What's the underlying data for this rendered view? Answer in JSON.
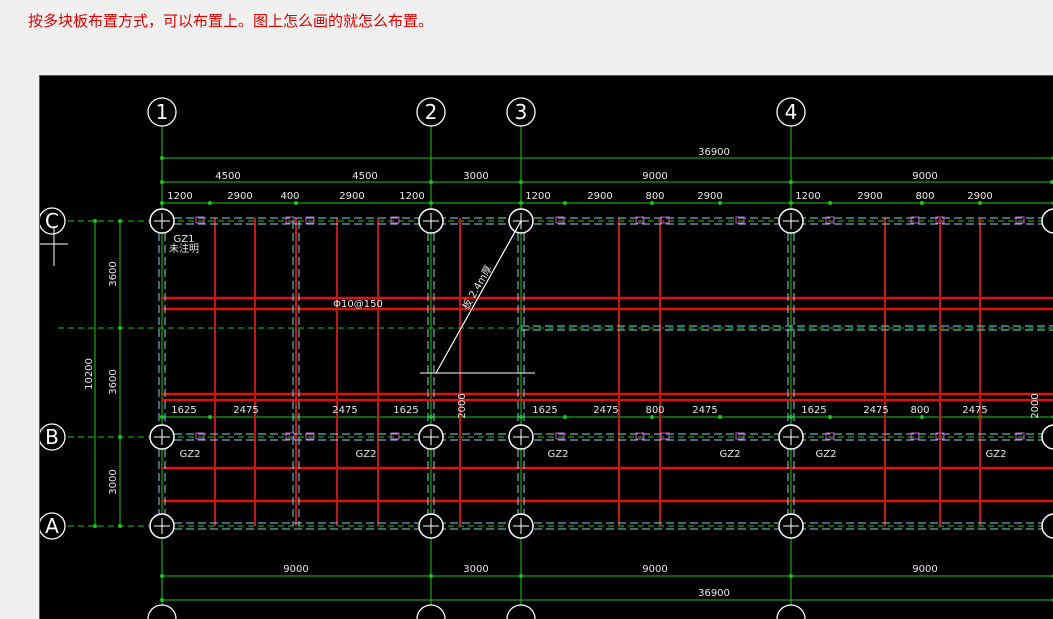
{
  "instruction_note": "按多块板布置方式，可以布置上。图上怎么画的就怎么布置。",
  "drawing": {
    "grid_columns": [
      "1",
      "2",
      "3",
      "4"
    ],
    "grid_rows": [
      "C",
      "B",
      "A"
    ],
    "overall_dimension_top": "36900",
    "top_spans": [
      "4500",
      "4500",
      "3000",
      "9000",
      "9000"
    ],
    "top_detail_dims": [
      "1200",
      "2900",
      "400",
      "2900",
      "1200",
      "1200",
      "2900",
      "800",
      "2900",
      "1200",
      "2900",
      "800",
      "2900"
    ],
    "left_dims": [
      "3600",
      "3600",
      "3000"
    ],
    "left_total": "10200",
    "mid_detail_dims": [
      "1625",
      "2475",
      "2475",
      "1625",
      "1625",
      "2475",
      "800",
      "2475",
      "1625",
      "2475",
      "800",
      "2475"
    ],
    "bottom_spans": [
      "9000",
      "3000",
      "9000",
      "9000"
    ],
    "overall_dimension_bottom": "36900",
    "vertical_note_2000": "2000",
    "rebar_label": "Φ10@150",
    "column_tag_top": "GZ1",
    "column_tag_top_sub": "未注明",
    "column_tag": "GZ2",
    "diagonal_label": "板 2.4m厚"
  }
}
